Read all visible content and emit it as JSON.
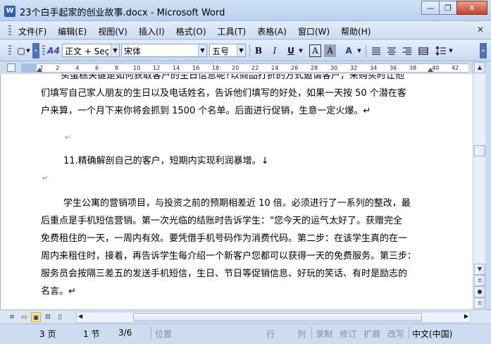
{
  "window": {
    "app_icon_letter": "W",
    "title": "23个白手起家的创业故事.docx - Microsoft Word",
    "minimize_glyph": "—",
    "maximize_glyph": "❐",
    "close_glyph": "✕"
  },
  "menu": {
    "items": [
      "文件(F)",
      "编辑(E)",
      "视图(V)",
      "插入(I)",
      "格式(O)",
      "工具(T)",
      "表格(A)",
      "窗口(W)",
      "帮助(H)"
    ],
    "close_glyph": "✕"
  },
  "toolbar": {
    "style_icon": "A4",
    "style_value": "正文 + Seç",
    "font_value": "宋体",
    "size_value": "五号",
    "bold": "B",
    "italic": "I",
    "underline": "U",
    "char_border": "A",
    "char_shading": "A",
    "highlight": "A",
    "new_doc_glyph": "▢",
    "dropdown_glyph": "▼",
    "chevron_glyph": "»"
  },
  "ruler": {
    "numbers": [
      "2",
      "2",
      "4",
      "6",
      "8",
      "10",
      "12",
      "14",
      "16",
      "18",
      "20",
      "22",
      "24",
      "26",
      "28",
      "30",
      "32",
      "34",
      "36",
      "38",
      "40",
      "42"
    ]
  },
  "document": {
    "lines": [
      "买蛋糕关键是如何获取客户的生日信息呢?以商品打折的方式邀请客户，来购买时让他",
      "们填写自己家人朋友的生日以及电话姓名，告诉他们填写的好处，如果一天按 50 个潜在客",
      "户来算，一个月下来你将会抓到 1500 个名单。后面进行促销，生意一定火爆。↵",
      "",
      "↵",
      "11.精确解剖自己的客户，短期内实现利润暴增。↓",
      "↵",
      "",
      "学生公寓的营销项目，与投资之前的预期相差近 10 倍。必须进行了一系列的整改，最",
      "后重点是手机短信营销。第一次光临的结账时告诉学生：\"您今天的运气太好了。获赠完全",
      "免费租住的一天，一周内有效。要凭借手机号码作为消费代码。第二步：在该学生真的在一",
      "周内来租住时，接着，再告诉学生每介绍一个新客户您都可以获得一天的免费服务。第三步：",
      "服务员会按隔三差五的发送手机短信，生日、节日等促销信息、好玩的笑话、有时是励志的",
      "名言。↵"
    ]
  },
  "scrollbar": {
    "up_glyph": "▲",
    "down_glyph": "▼",
    "prev_page_glyph": "±",
    "select_browse_glyph": "●",
    "next_page_glyph": "±"
  },
  "view_buttons": [
    "≡",
    "▭",
    "▣",
    "⊟",
    "▯"
  ],
  "hscroll": {
    "left_glyph": "◀",
    "right_glyph": "▶"
  },
  "status": {
    "page": "3 页",
    "section": "1 节",
    "page_of": "3/6",
    "position": "位置",
    "line": "行",
    "column": "列",
    "rec": "录制",
    "trk": "修订",
    "ext": "扩展",
    "ovr": "改写",
    "language": "中文(中国)"
  }
}
